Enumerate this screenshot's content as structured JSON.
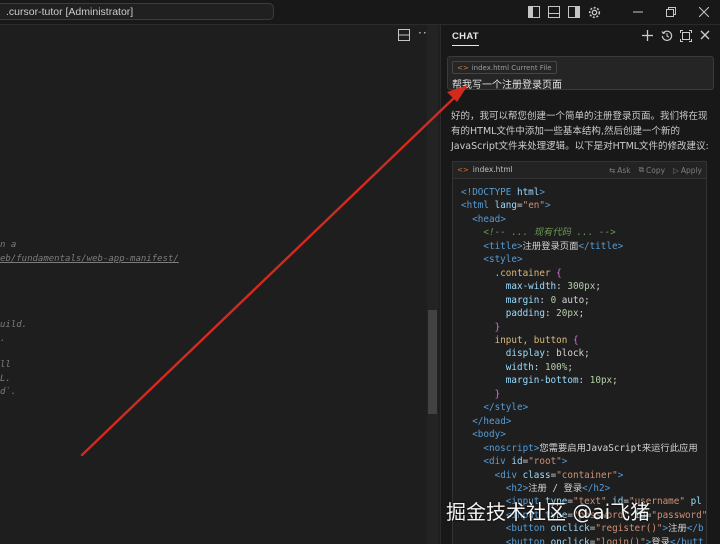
{
  "titlebar": {
    "search_text": ".cursor-tutor [Administrator]",
    "icons": [
      "toggle-primary-sidebar-icon",
      "toggle-panel-icon",
      "toggle-secondary-sidebar-icon",
      "customize-layout-icon"
    ],
    "window_buttons": [
      "minimize",
      "restore",
      "close"
    ]
  },
  "editor": {
    "fragments": [
      "n a",
      "eb/fundamentals/web-app-manifest/",
      "uild.",
      ".",
      "ll",
      "L.",
      "d`."
    ]
  },
  "chat": {
    "title": "CHAT",
    "header_icons": [
      "new-chat-icon",
      "history-icon",
      "maximize-icon",
      "close-icon"
    ],
    "user_message": {
      "file_chip": "index.html  Current File",
      "text": "帮我写一个注册登录页面"
    },
    "answer": "好的，我可以帮您创建一个简单的注册登录页面。我们将在现有的HTML文件中添加一些基本结构,然后创建一个新的JavaScript文件来处理逻辑。以下是对HTML文件的修改建议:",
    "code_block": {
      "filename": "index.html",
      "actions": {
        "ask": "Ask",
        "copy": "Copy",
        "apply": "Apply"
      },
      "lines": [
        "<!DOCTYPE html>",
        "<html lang=\"en\">",
        "  <head>",
        "    <!-- ... 现有代码 ... -->",
        "    <title>注册登录页面</title>",
        "    <style>",
        "      .container {",
        "        max-width: 300px;",
        "        margin: 0 auto;",
        "        padding: 20px;",
        "      }",
        "      input, button {",
        "        display: block;",
        "        width: 100%;",
        "        margin-bottom: 10px;",
        "      }",
        "    </style>",
        "  </head>",
        "  <body>",
        "    <noscript>您需要启用JavaScript来运行此应用",
        "    <div id=\"root\">",
        "      <div class=\"container\">",
        "        <h2>注册 / 登录</h2>",
        "        <input type=\"text\" id=\"username\" pl",
        "        <input type=\"password\" id=\"password\"",
        "        <button onclick=\"register()\">注册</b",
        "        <button onclick=\"login()\">登录</butt"
      ]
    }
  },
  "watermark": "掘金技术社区 @ai飞猪",
  "colors": {
    "annotation_arrow": "#d42a1e",
    "accent": "#e37933"
  }
}
